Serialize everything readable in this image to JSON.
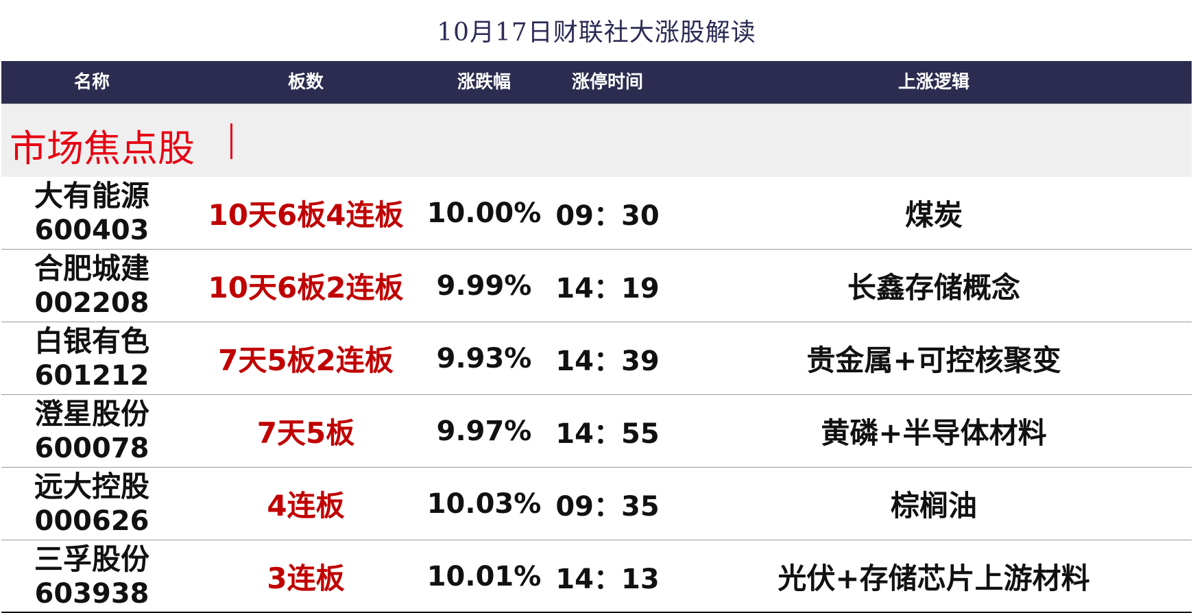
{
  "title": "10月17日财联社大涨股解读",
  "columns": {
    "name": "名称",
    "boards": "板数",
    "change": "涨跌幅",
    "limit_time": "涨停时间",
    "logic": "上涨逻辑"
  },
  "section": {
    "title": "市场焦点股"
  },
  "colors": {
    "header_bg": "#2c2c50",
    "section_title": "#e60012",
    "board_text": "#c00000",
    "section_bg": "#efefef"
  },
  "rows": [
    {
      "name": "大有能源",
      "code": "600403",
      "boards": "10天6板4连板",
      "change": "10.00%",
      "time": "09：30",
      "logic": "煤炭"
    },
    {
      "name": "合肥城建",
      "code": "002208",
      "boards": "10天6板2连板",
      "change": "9.99%",
      "time": "14：19",
      "logic": "长鑫存储概念"
    },
    {
      "name": "白银有色",
      "code": "601212",
      "boards": "7天5板2连板",
      "change": "9.93%",
      "time": "14：39",
      "logic": "贵金属+可控核聚变"
    },
    {
      "name": "澄星股份",
      "code": "600078",
      "boards": "7天5板",
      "change": "9.97%",
      "time": "14：55",
      "logic": "黄磷+半导体材料"
    },
    {
      "name": "远大控股",
      "code": "000626",
      "boards": "4连板",
      "change": "10.03%",
      "time": "09：35",
      "logic": "棕榈油"
    },
    {
      "name": "三孚股份",
      "code": "603938",
      "boards": "3连板",
      "change": "10.01%",
      "time": "14：13",
      "logic": "光伏+存储芯片上游材料"
    }
  ]
}
